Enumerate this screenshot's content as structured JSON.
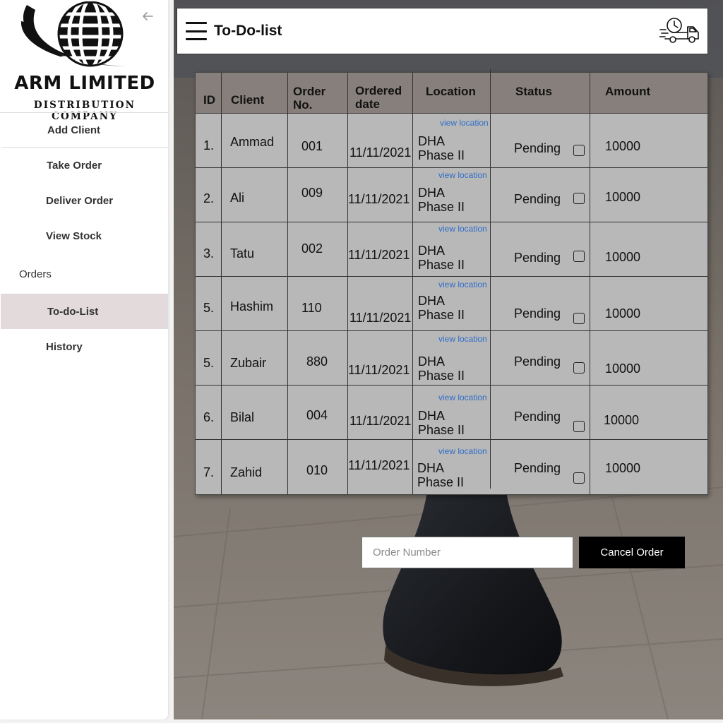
{
  "brand": {
    "name": "ARM LIMITED",
    "subtitle": "DISTRIBUTION COMPANY"
  },
  "sidebar": {
    "items": [
      {
        "label": "Add Client"
      },
      {
        "label": "Take Order"
      },
      {
        "label": "Deliver Order"
      },
      {
        "label": "View Stock"
      },
      {
        "label": "Orders"
      },
      {
        "label": "To-do-List",
        "active": true
      },
      {
        "label": "History"
      }
    ]
  },
  "header": {
    "title": "To-Do-list"
  },
  "table": {
    "headers": {
      "id": "ID",
      "client": "Client",
      "order_no": "Order No.",
      "ordered_date": "Ordered date",
      "location": "Location",
      "status": "Status",
      "amount": "Amount"
    },
    "rows": [
      {
        "id": "1.",
        "client": "Ammad",
        "order_no": "001",
        "date": "11/11/2021",
        "view": "view location",
        "loc1": "DHA",
        "loc2": "Phase II",
        "status": "Pending",
        "amount": "10000"
      },
      {
        "id": "2.",
        "client": "Ali",
        "order_no": "009",
        "date": "11/11/2021",
        "view": "view location",
        "loc1": "DHA",
        "loc2": "Phase II",
        "status": "Pending",
        "amount": "10000"
      },
      {
        "id": "3.",
        "client": "Tatu",
        "order_no": "002",
        "date": "11/11/2021",
        "view": "view location",
        "loc1": "DHA",
        "loc2": "Phase II",
        "status": "Pending",
        "amount": "10000"
      },
      {
        "id": "5.",
        "client": "Hashim",
        "order_no": "110",
        "date": "11/11/2021",
        "view": "view location",
        "loc1": "DHA",
        "loc2": "Phase II",
        "status": "Pending",
        "amount": "10000"
      },
      {
        "id": "5.",
        "client": "Zubair",
        "order_no": "880",
        "date": "11/11/2021",
        "view": "view location",
        "loc1": "DHA",
        "loc2": "Phase II",
        "status": "Pending",
        "amount": "10000"
      },
      {
        "id": "6.",
        "client": "Bilal",
        "order_no": "004",
        "date": "11/11/2021",
        "view": "view location",
        "loc1": "DHA",
        "loc2": "Phase II",
        "status": "Pending",
        "amount": "10000"
      },
      {
        "id": "7.",
        "client": "Zahid",
        "order_no": "010",
        "date": "11/11/2021",
        "view": "view location",
        "loc1": "DHA",
        "loc2": "Phase II",
        "status": "Pending",
        "amount": "10000"
      }
    ]
  },
  "form": {
    "order_placeholder": "Order Number",
    "cancel_label": "Cancel Order"
  },
  "icons": {
    "collapse": "arrow-left-icon",
    "menu": "hamburger-menu-icon",
    "delivery": "delivery-truck-icon",
    "logo": "globe-logo-icon"
  },
  "colors": {
    "table_header": "#877f7c",
    "table_body": "#b8b8b8",
    "active_nav": "#e2dadb",
    "link": "#2f6ec9",
    "button": "#000000"
  }
}
